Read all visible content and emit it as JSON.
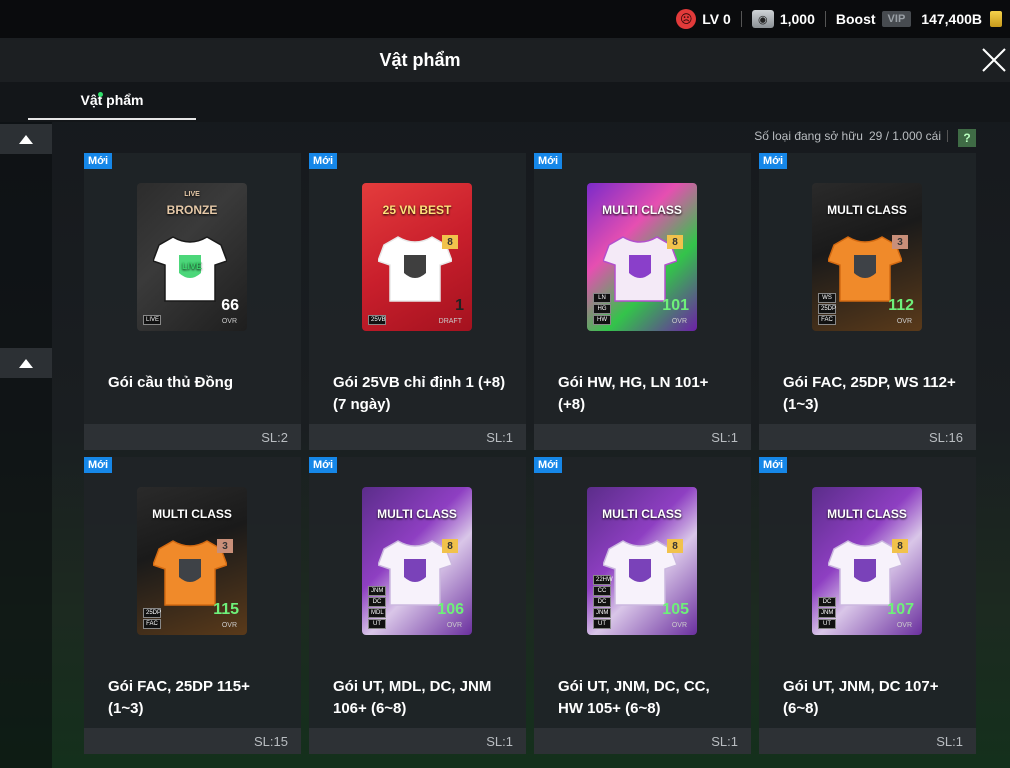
{
  "topbar": {
    "level": "LV 0",
    "coins": "1,000",
    "boost_label": "Boost",
    "vip_label": "VIP",
    "bp": "147,400B"
  },
  "header": {
    "title": "Vật phẩm"
  },
  "tabs": [
    {
      "label": "Vật phẩm",
      "active": true
    }
  ],
  "inventory": {
    "count_label": "Số loại đang sở hữu",
    "count_value": "29 / 1.000 cái",
    "help": "?"
  },
  "new_badge": "Mới",
  "items": [
    {
      "pack_title_top": "LIVE",
      "pack_title": "BRONZE",
      "shirt_label": "LIVE",
      "grade": "",
      "ovr": "66",
      "ovr_label": "OVR",
      "tags": [
        "LIVE"
      ],
      "name": "Gói cầu thủ Đồng",
      "qty": "SL:2",
      "theme": "bronze"
    },
    {
      "pack_title_top": "",
      "pack_title": "25 VN BEST",
      "shirt_label": "",
      "grade": "8",
      "ovr": "1",
      "ovr_label": "DRAFT",
      "tags": [
        "25VB"
      ],
      "name": "Gói 25VB chỉ định 1 (+8) (7 ngày)",
      "qty": "SL:1",
      "theme": "vnbest"
    },
    {
      "pack_title_top": "",
      "pack_title": "MULTI CLASS",
      "shirt_label": "",
      "grade": "8",
      "ovr": "101",
      "ovr_label": "OVR",
      "tags": [
        "LN",
        "HG",
        "HW"
      ],
      "name": "Gói HW, HG, LN 101+ (+8)",
      "qty": "SL:1",
      "theme": "hwhg"
    },
    {
      "pack_title_top": "",
      "pack_title": "MULTI CLASS",
      "shirt_label": "",
      "grade": "3",
      "ovr": "112",
      "ovr_label": "OVR",
      "tags": [
        "WS",
        "25DP",
        "FAC"
      ],
      "name": "Gói FAC, 25DP, WS 112+ (1~3)",
      "qty": "SL:16",
      "theme": "fac"
    },
    {
      "pack_title_top": "",
      "pack_title": "MULTI CLASS",
      "shirt_label": "",
      "grade": "3",
      "ovr": "115",
      "ovr_label": "OVR",
      "tags": [
        "25DP",
        "FAC"
      ],
      "name": "Gói FAC, 25DP 115+ (1~3)",
      "qty": "SL:15",
      "theme": "fac"
    },
    {
      "pack_title_top": "",
      "pack_title": "MULTI CLASS",
      "shirt_label": "",
      "grade": "8",
      "ovr": "106",
      "ovr_label": "OVR",
      "tags": [
        "JNM",
        "DC",
        "MDL",
        "UT"
      ],
      "name": "Gói UT, MDL, DC, JNM 106+ (6~8)",
      "qty": "SL:1",
      "theme": "ut"
    },
    {
      "pack_title_top": "",
      "pack_title": "MULTI CLASS",
      "shirt_label": "",
      "grade": "8",
      "ovr": "105",
      "ovr_label": "OVR",
      "tags": [
        "22HW",
        "CC",
        "DC",
        "JNM",
        "UT"
      ],
      "name": "Gói UT, JNM, DC, CC, HW 105+ (6~8)",
      "qty": "SL:1",
      "theme": "ut"
    },
    {
      "pack_title_top": "",
      "pack_title": "MULTI CLASS",
      "shirt_label": "",
      "grade": "8",
      "ovr": "107",
      "ovr_label": "OVR",
      "tags": [
        "DC",
        "JNM",
        "UT"
      ],
      "name": "Gói UT, JNM, DC 107+ (6~8)",
      "qty": "SL:1",
      "theme": "ut"
    }
  ],
  "colors": {
    "accent_green": "#32e06b",
    "new_badge": "#1687e8",
    "help_green": "#3f6b45"
  }
}
